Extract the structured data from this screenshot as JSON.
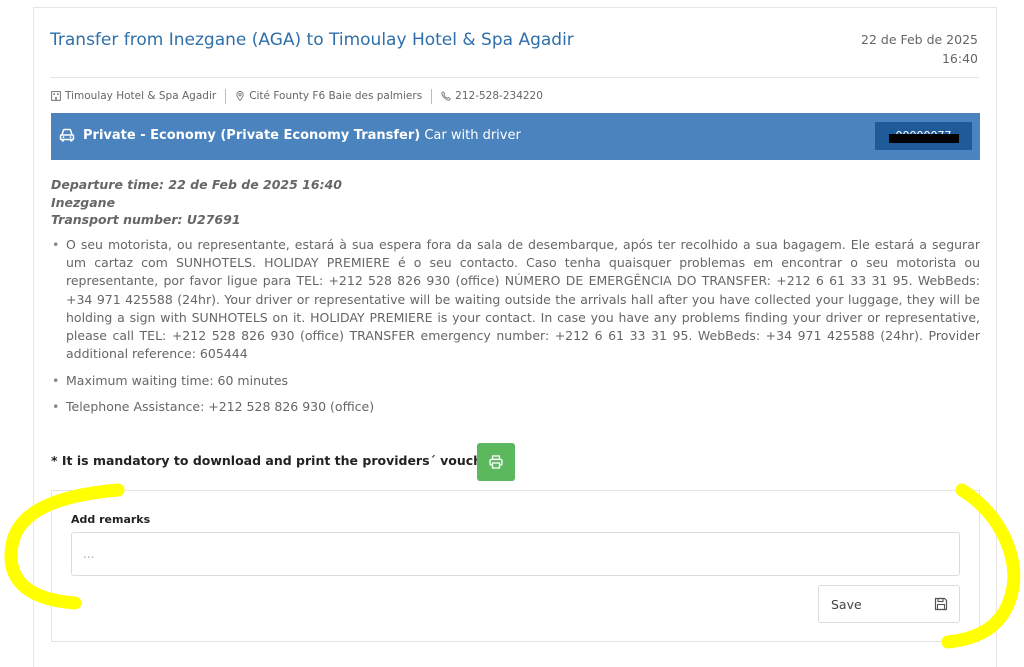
{
  "transfer": {
    "title": "Transfer from Inezgane (AGA) to Timoulay Hotel & Spa Agadir",
    "date": "22 de Feb de 2025",
    "time": "16:40"
  },
  "info": {
    "hotel": "Timoulay Hotel & Spa Agadir",
    "address": "Cité Founty F6 Baie des palmiers",
    "phone": "212-528-234220"
  },
  "service": {
    "type_bold": "Private - Economy (Private Economy Transfer)",
    "type_rest": " Car with driver",
    "reference": "00000077",
    "color": "#4a83bd"
  },
  "departure": {
    "time_line": "Departure time: 22 de Feb de 2025 16:40",
    "place": "Inezgane",
    "transport_number": "Transport number: U27691"
  },
  "notes": [
    "O seu motorista, ou representante, estará à sua espera fora da sala de desembarque, após ter recolhido a sua bagagem. Ele estará a segurar um cartaz com SUNHOTELS. HOLIDAY PREMIERE é o seu contacto. Caso tenha quaisquer problemas em encontrar o seu motorista ou representante, por favor ligue para TEL: +212 528 826 930 (office) NÚMERO DE EMERGÊNCIA DO TRANSFER: +212 6 61 33 31 95. WebBeds: +34 971 425588 (24hr). Your driver or representative will be waiting outside the arrivals hall after you have collected your luggage, they will be holding a sign with SUNHOTELS on it. HOLIDAY PREMIERE is your contact. In case you have any problems finding your driver or representative, please call TEL: +212 528 826 930 (office) TRANSFER emergency number: +212 6 61 33 31 95. WebBeds: +34 971 425588 (24hr). Provider additional reference: 605444",
    "Maximum waiting time: 60 minutes",
    "Telephone Assistance: +212 528 826 930 (office)"
  ],
  "voucher": {
    "mandatory_text": "* It is mandatory to download and print the providers´ voucher",
    "button_color": "#5cb85c"
  },
  "remarks": {
    "label": "Add remarks",
    "placeholder": "...",
    "value": "",
    "save_label": "Save"
  },
  "annotation_color": "#ffff00"
}
